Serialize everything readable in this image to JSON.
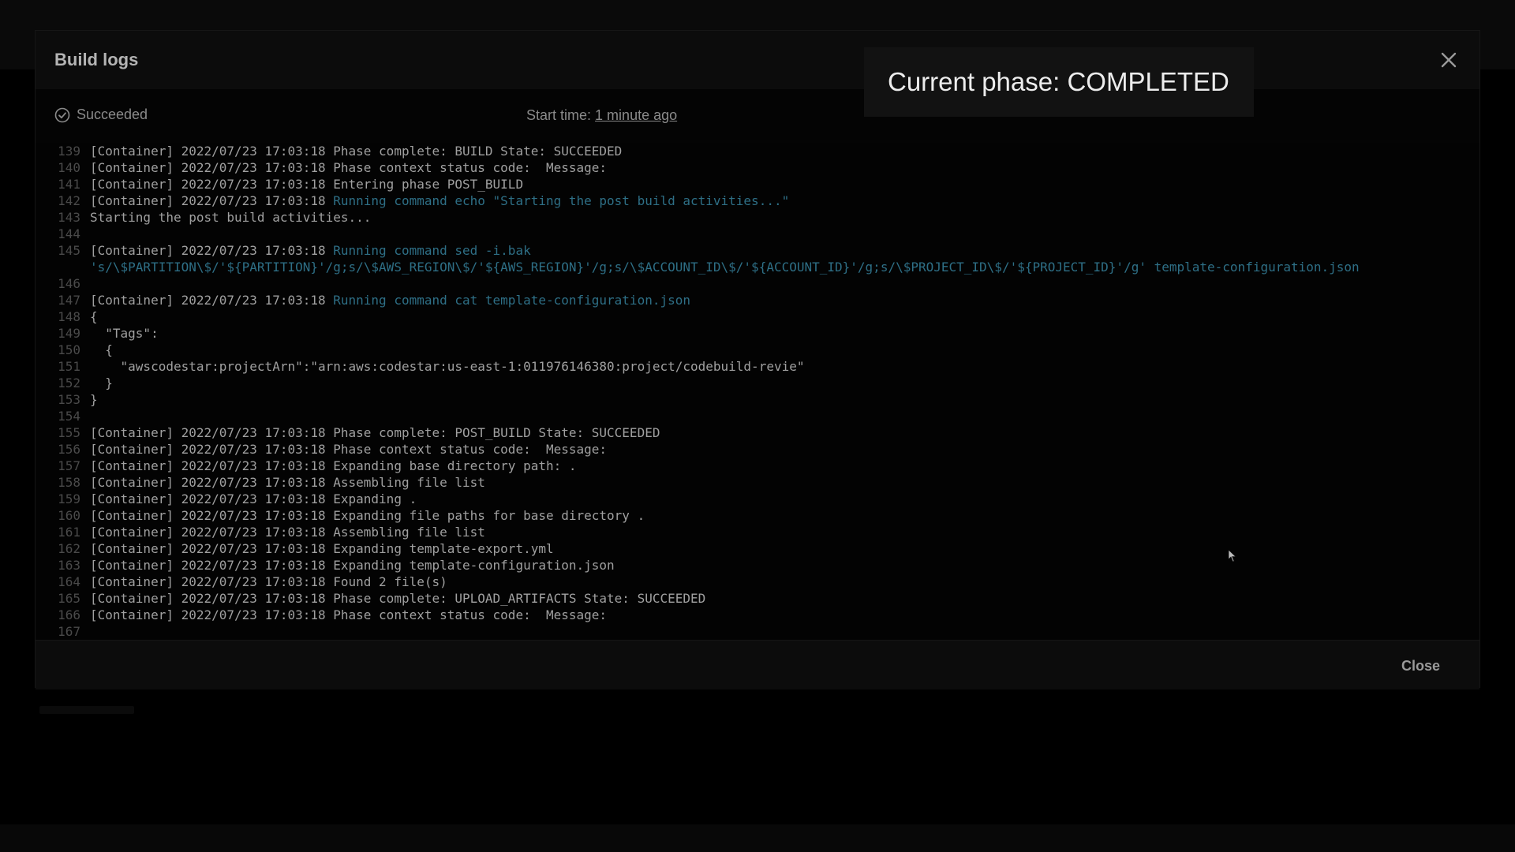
{
  "modal": {
    "title": "Build logs",
    "close_label": "Close"
  },
  "status": {
    "state": "Succeeded",
    "start_time_label": "Start time:",
    "start_time_value": "1 minute ago"
  },
  "tooltip": {
    "text": "Current phase: COMPLETED"
  },
  "icons": {
    "close": "close-icon",
    "status": "check-circle-icon",
    "cursor": "mouse-pointer-icon"
  },
  "colors": {
    "command_text": "#2e6f86",
    "log_text": "#a0a0a0",
    "line_number": "#4a4a4a"
  },
  "log_lines": [
    {
      "n": "139",
      "pre": "[Container] 2022/07/23 17:03:18 Phase complete: BUILD State: SUCCEEDED",
      "cmd": ""
    },
    {
      "n": "140",
      "pre": "[Container] 2022/07/23 17:03:18 Phase context status code:  Message:",
      "cmd": ""
    },
    {
      "n": "141",
      "pre": "[Container] 2022/07/23 17:03:18 Entering phase POST_BUILD",
      "cmd": ""
    },
    {
      "n": "142",
      "pre": "[Container] 2022/07/23 17:03:18 ",
      "cmd": "Running command echo \"Starting the post build activities...\""
    },
    {
      "n": "143",
      "pre": "Starting the post build activities...",
      "cmd": ""
    },
    {
      "n": "144",
      "pre": "",
      "cmd": ""
    },
    {
      "n": "145",
      "pre": "[Container] 2022/07/23 17:03:18 ",
      "cmd": "Running command sed -i.bak"
    },
    {
      "n": "",
      "pre": "",
      "cmd": "'s/\\$PARTITION\\$/'${PARTITION}'/g;s/\\$AWS_REGION\\$/'${AWS_REGION}'/g;s/\\$ACCOUNT_ID\\$/'${ACCOUNT_ID}'/g;s/\\$PROJECT_ID\\$/'${PROJECT_ID}'/g' template-configuration.json"
    },
    {
      "n": "146",
      "pre": "",
      "cmd": ""
    },
    {
      "n": "147",
      "pre": "[Container] 2022/07/23 17:03:18 ",
      "cmd": "Running command cat template-configuration.json"
    },
    {
      "n": "148",
      "pre": "{",
      "cmd": ""
    },
    {
      "n": "149",
      "pre": "  \"Tags\":",
      "cmd": ""
    },
    {
      "n": "150",
      "pre": "  {",
      "cmd": ""
    },
    {
      "n": "151",
      "pre": "    \"awscodestar:projectArn\":\"arn:aws:codestar:us-east-1:011976146380:project/codebuild-revie\"",
      "cmd": ""
    },
    {
      "n": "152",
      "pre": "  }",
      "cmd": ""
    },
    {
      "n": "153",
      "pre": "}",
      "cmd": ""
    },
    {
      "n": "154",
      "pre": "",
      "cmd": ""
    },
    {
      "n": "155",
      "pre": "[Container] 2022/07/23 17:03:18 Phase complete: POST_BUILD State: SUCCEEDED",
      "cmd": ""
    },
    {
      "n": "156",
      "pre": "[Container] 2022/07/23 17:03:18 Phase context status code:  Message:",
      "cmd": ""
    },
    {
      "n": "157",
      "pre": "[Container] 2022/07/23 17:03:18 Expanding base directory path: .",
      "cmd": ""
    },
    {
      "n": "158",
      "pre": "[Container] 2022/07/23 17:03:18 Assembling file list",
      "cmd": ""
    },
    {
      "n": "159",
      "pre": "[Container] 2022/07/23 17:03:18 Expanding .",
      "cmd": ""
    },
    {
      "n": "160",
      "pre": "[Container] 2022/07/23 17:03:18 Expanding file paths for base directory .",
      "cmd": ""
    },
    {
      "n": "161",
      "pre": "[Container] 2022/07/23 17:03:18 Assembling file list",
      "cmd": ""
    },
    {
      "n": "162",
      "pre": "[Container] 2022/07/23 17:03:18 Expanding template-export.yml",
      "cmd": ""
    },
    {
      "n": "163",
      "pre": "[Container] 2022/07/23 17:03:18 Expanding template-configuration.json",
      "cmd": ""
    },
    {
      "n": "164",
      "pre": "[Container] 2022/07/23 17:03:18 Found 2 file(s)",
      "cmd": ""
    },
    {
      "n": "165",
      "pre": "[Container] 2022/07/23 17:03:18 Phase complete: UPLOAD_ARTIFACTS State: SUCCEEDED",
      "cmd": ""
    },
    {
      "n": "166",
      "pre": "[Container] 2022/07/23 17:03:18 Phase context status code:  Message:",
      "cmd": ""
    },
    {
      "n": "167",
      "pre": "",
      "cmd": ""
    }
  ]
}
